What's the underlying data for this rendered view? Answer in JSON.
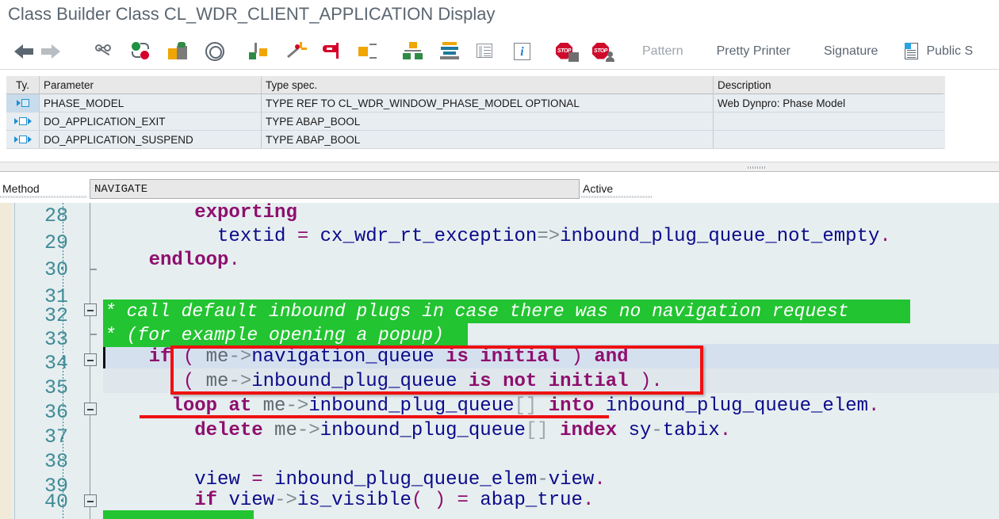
{
  "window": {
    "title": "Class Builder Class CL_WDR_CLIENT_APPLICATION Display"
  },
  "mini_toolbar": {
    "icons": [
      "globe-icon",
      "pin-icon",
      "undo-icon",
      "semicolon-icon",
      "keyboard-icon",
      "magnifier-icon",
      "gear-icon"
    ]
  },
  "toolbar": {
    "items": [
      {
        "name": "back-icon",
        "label": ""
      },
      {
        "name": "forward-icon",
        "label": ""
      },
      {
        "name": "display-change-icon",
        "label": ""
      },
      {
        "name": "check-syntax-icon",
        "label": ""
      },
      {
        "name": "activate-icon",
        "label": ""
      },
      {
        "name": "spiral-icon",
        "label": ""
      },
      {
        "name": "where-used-icon",
        "label": ""
      },
      {
        "name": "wand-icon",
        "label": ""
      },
      {
        "name": "filter-icon",
        "label": ""
      },
      {
        "name": "split-icon",
        "label": ""
      },
      {
        "name": "hierarchy-icon",
        "label": ""
      },
      {
        "name": "stack-icon",
        "label": ""
      },
      {
        "name": "list-icon",
        "label": ""
      },
      {
        "name": "info-icon",
        "label": ""
      },
      {
        "name": "breakpoint-icon",
        "label": ""
      },
      {
        "name": "breakpoint-user-icon",
        "label": ""
      }
    ],
    "pattern_label": "Pattern",
    "pretty_printer_label": "Pretty Printer",
    "signature_label": "Signature",
    "public_section_label": "Public S"
  },
  "parameter_table": {
    "columns": [
      "Ty.",
      "Parameter",
      "Type spec.",
      "Description"
    ],
    "rows": [
      {
        "ty_icon": "importing-parameter-icon",
        "selected": true,
        "parameter": "PHASE_MODEL",
        "type_spec": "TYPE REF TO CL_WDR_WINDOW_PHASE_MODEL OPTIONAL",
        "description": "Web Dynpro: Phase Model"
      },
      {
        "ty_icon": "changing-parameter-icon",
        "selected": false,
        "parameter": "DO_APPLICATION_EXIT",
        "type_spec": "TYPE ABAP_BOOL",
        "description": ""
      },
      {
        "ty_icon": "changing-parameter-icon",
        "selected": false,
        "parameter": "DO_APPLICATION_SUSPEND",
        "type_spec": "TYPE ABAP_BOOL",
        "description": ""
      }
    ]
  },
  "method_bar": {
    "label": "Method",
    "value": "NAVIGATE",
    "status": "Active"
  },
  "editor": {
    "line_numbers": [
      "28",
      "29",
      "30",
      "31",
      "32",
      "33",
      "34",
      "35",
      "36",
      "37",
      "38",
      "39",
      "40"
    ],
    "lines": [
      {
        "number": "28",
        "text": "        exporting"
      },
      {
        "number": "29",
        "text": "          textid = cx_wdr_rt_exception=>inbound_plug_queue_not_empty."
      },
      {
        "number": "30",
        "text": "    endloop."
      },
      {
        "number": "31",
        "text": ""
      },
      {
        "number": "32",
        "text": "* call default inbound plugs in case there was no navigation request"
      },
      {
        "number": "33",
        "text": "* (for example opening a popup)"
      },
      {
        "number": "34",
        "text": "    if ( me->navigation_queue is initial ) and"
      },
      {
        "number": "35",
        "text": "       ( me->inbound_plug_queue is not initial )."
      },
      {
        "number": "36",
        "text": "      loop at me->inbound_plug_queue[] into inbound_plug_queue_elem."
      },
      {
        "number": "37",
        "text": "        delete me->inbound_plug_queue[] index sy-tabix."
      },
      {
        "number": "38",
        "text": ""
      },
      {
        "number": "39",
        "text": "        view = inbound_plug_queue_elem-view."
      },
      {
        "number": "40",
        "text": "        if view->is_visible( ) = abap_true."
      }
    ]
  },
  "colors": {
    "editor_background": "#e6eef0",
    "comment_background": "#22c431",
    "comment_text": "#ffffff",
    "keyword": "#8e0f6e",
    "identifier": "#0b0b8a",
    "line_number": "#3f8b95",
    "annotation_red": "#ee1111",
    "current_line_highlight": "#d5e0ef",
    "table_header_background": "#e8e8e8",
    "table_row_background": "#e8edf1",
    "title_text": "#5b6671"
  }
}
